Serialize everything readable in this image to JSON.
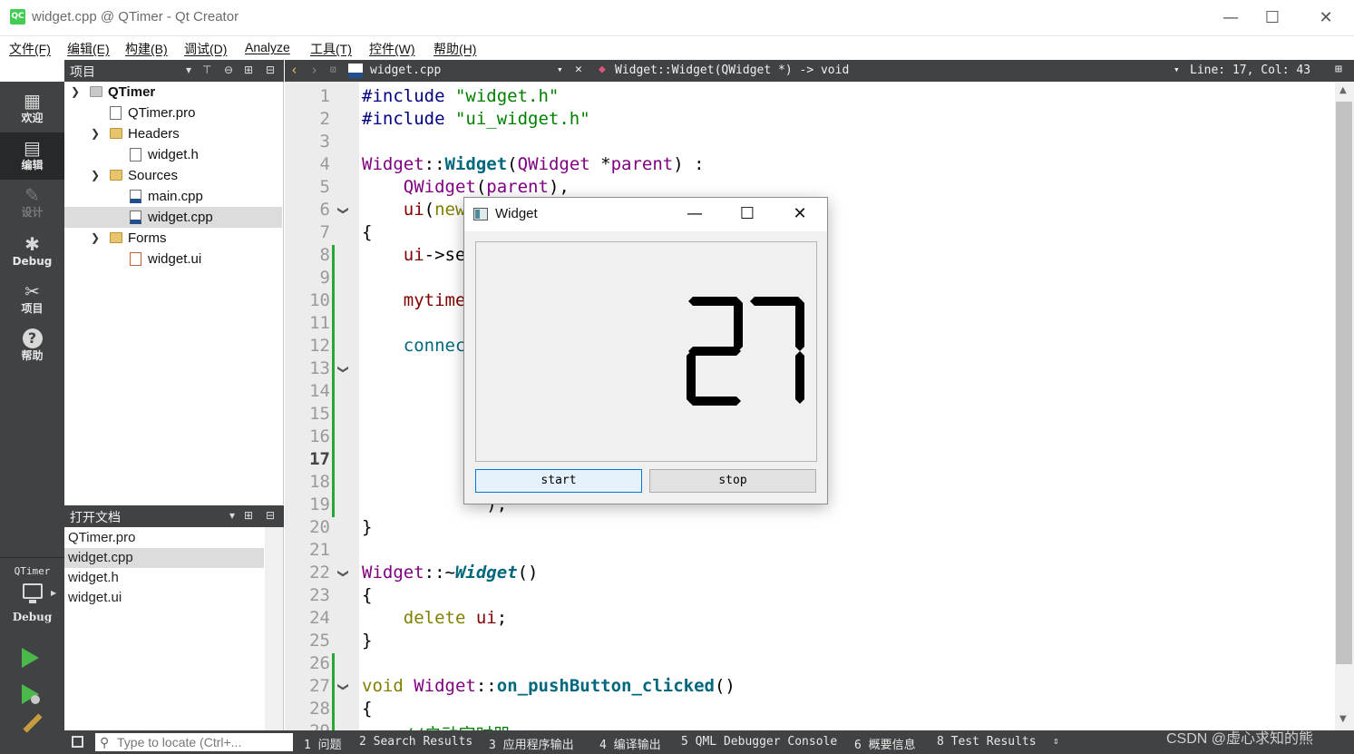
{
  "window": {
    "title": "widget.cpp @ QTimer - Qt Creator",
    "logo_text": "QC",
    "controls": [
      "—",
      "☐",
      "✕"
    ]
  },
  "menu": [
    "文件(F)",
    "编辑(E)",
    "构建(B)",
    "调试(D)",
    "Analyze",
    "工具(T)",
    "控件(W)",
    "帮助(H)"
  ],
  "modes": [
    {
      "label": "欢迎",
      "icon": "welcome-grid-icon",
      "glyph": "▦"
    },
    {
      "label": "编辑",
      "icon": "edit-document-icon",
      "glyph": "▤"
    },
    {
      "label": "设计",
      "icon": "design-pen-icon",
      "glyph": "✎"
    },
    {
      "label": "Debug",
      "icon": "debug-bug-icon",
      "glyph": "✱"
    },
    {
      "label": "项目",
      "icon": "project-wrench-icon",
      "glyph": "✂"
    },
    {
      "label": "帮助",
      "icon": "help-question-icon",
      "glyph": "?"
    }
  ],
  "kit": {
    "project": "QTimer",
    "mode": "Debug",
    "icon": "monitor-icon"
  },
  "run_actions": {
    "run": "run-icon",
    "debug": "run-debug-icon",
    "build": "build-hammer-icon"
  },
  "project_pane": {
    "title": "项目",
    "tree": [
      {
        "label": "QTimer",
        "bold": true
      },
      {
        "label": "QTimer.pro"
      },
      {
        "label": "Headers"
      },
      {
        "label": "widget.h"
      },
      {
        "label": "Sources"
      },
      {
        "label": "main.cpp"
      },
      {
        "label": "widget.cpp",
        "selected": true
      },
      {
        "label": "Forms"
      },
      {
        "label": "widget.ui"
      }
    ]
  },
  "open_docs": {
    "title": "打开文档",
    "items": [
      "QTimer.pro",
      "widget.cpp",
      "widget.h",
      "widget.ui"
    ],
    "selected": "widget.cpp"
  },
  "editor": {
    "file": "widget.cpp",
    "symbol": "Widget::Widget(QWidget *) -> void",
    "position": "Line: 17, Col: 43",
    "current_line": 17,
    "line_numbers": [
      1,
      2,
      3,
      4,
      5,
      6,
      7,
      8,
      9,
      10,
      11,
      12,
      13,
      14,
      15,
      16,
      17,
      18,
      19,
      20,
      21,
      22,
      23,
      24,
      25,
      26,
      27,
      28,
      29
    ],
    "fold_lines": [
      6,
      13,
      22,
      27
    ],
    "lines": [
      "#include \"widget.h\"",
      "#include \"ui_widget.h\"",
      "",
      "Widget::Widget(QWidget *parent) :",
      "    QWidget(parent),",
      "    ui(new",
      "{",
      "    ui->se",
      "",
      "    mytime",
      "",
      "    connec",
      "",
      "",
      "",
      "",
      "",
      "",
      "            );",
      "}",
      "",
      "Widget::~Widget()",
      "{",
      "    delete ui;",
      "}",
      "",
      "void Widget::on_pushButton_clicked()",
      "{",
      "    //启动定时器"
    ]
  },
  "status": {
    "locator_placeholder": "Type to locate (Ctrl+...",
    "tabs": [
      "1 问题",
      "2 Search Results",
      "3 应用程序输出",
      "4 编译输出",
      "5 QML Debugger Console",
      "6 概要信息",
      "8 Test Results"
    ],
    "watermark": "CSDN @虚心求知的熊"
  },
  "widget_window": {
    "title": "Widget",
    "lcd_value": "27",
    "start_label": "start",
    "stop_label": "stop"
  }
}
